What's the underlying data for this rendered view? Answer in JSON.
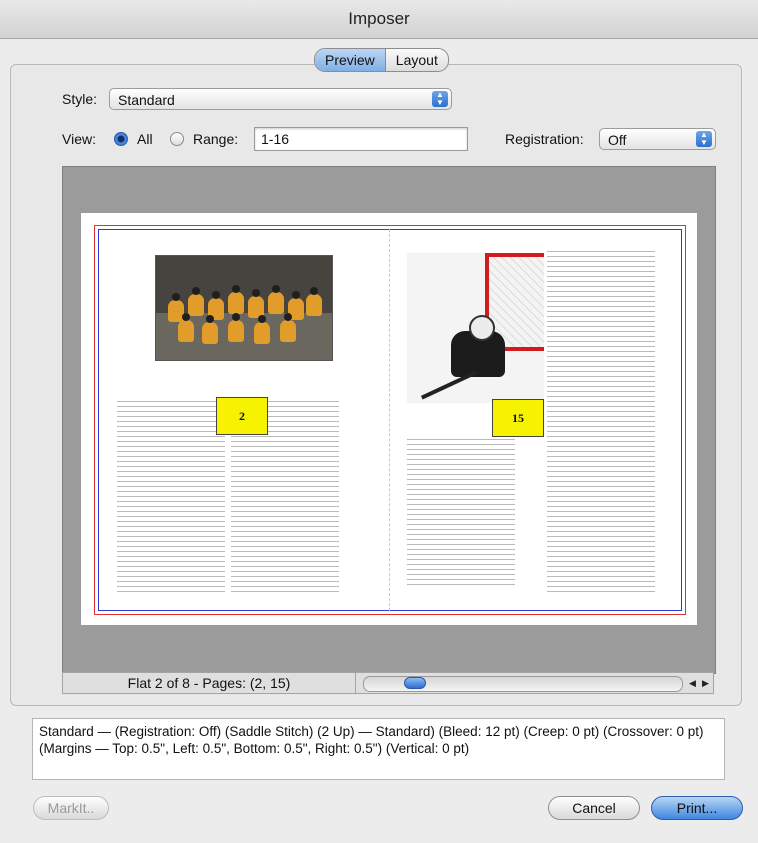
{
  "window": {
    "title": "Imposer"
  },
  "tabs": [
    {
      "label": "Preview",
      "active": true
    },
    {
      "label": "Layout",
      "active": false
    }
  ],
  "style": {
    "label": "Style:",
    "value": "Standard"
  },
  "view": {
    "label": "View:",
    "all_label": "All",
    "range_label": "Range:",
    "selected": "All",
    "range_value": "1-16"
  },
  "registration": {
    "label": "Registration:",
    "value": "Off"
  },
  "preview": {
    "left_page_number": "2",
    "right_page_number": "15",
    "colors": {
      "bleed_line": "#e03030",
      "trim_line": "#2a3bd8",
      "page_marker": "#f6f200"
    }
  },
  "status": {
    "flat_label": "Flat 2 of 8 - Pages: (2, 15)"
  },
  "summary": {
    "text": "Standard — (Registration: Off) (Saddle Stitch) (2 Up) — Standard) (Bleed: 12 pt) (Creep: 0 pt) (Crossover: 0 pt) (Margins — Top: 0.5\", Left: 0.5\", Bottom: 0.5\", Right: 0.5\") (Vertical: 0 pt)"
  },
  "buttons": {
    "markit": "MarkIt..",
    "cancel": "Cancel",
    "print": "Print..."
  }
}
